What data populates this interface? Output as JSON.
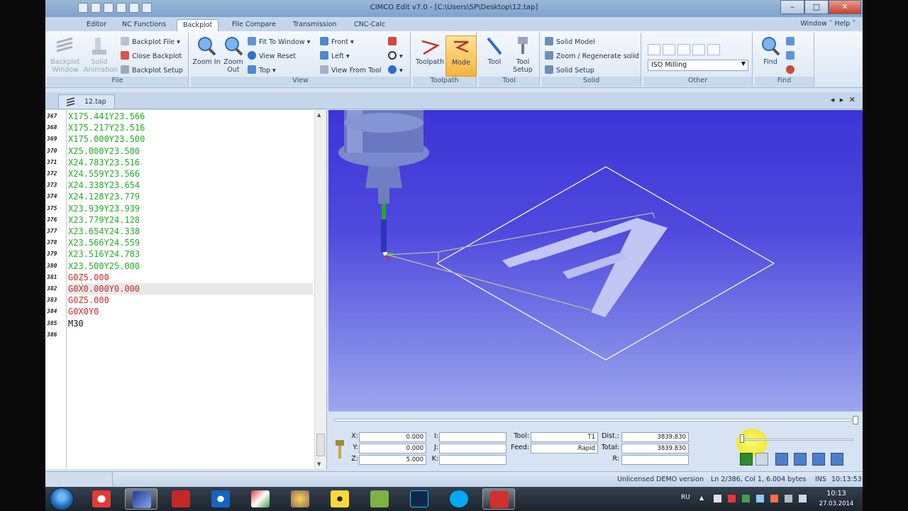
{
  "window": {
    "title": "CIMCO Edit v7.0 - [C:\\Users\\SP\\Desktop\\12.tap]",
    "min": "–",
    "max": "□",
    "close": "✕"
  },
  "menu": {
    "tabs": [
      "Editor",
      "NC Functions",
      "Backplot",
      "File Compare",
      "Transmission",
      "CNC-Calc"
    ],
    "active_tab": "Backplot",
    "right": "Window ˅  Help ˅"
  },
  "ribbon": {
    "file": {
      "label": "File",
      "backplot_window": "Backplot Window",
      "solid_animation": "Solid Animation",
      "backplot_file": "Backplot File",
      "close_backplot": "Close Backplot",
      "backplot_setup": "Backplot Setup"
    },
    "view": {
      "label": "View",
      "zoom_in": "Zoom In",
      "zoom_out": "Zoom Out",
      "fit_to_window": "Fit To Window",
      "view_reset": "View Reset",
      "top": "Top",
      "front": "Front",
      "left": "Left",
      "view_from_tool": "View From Tool"
    },
    "toolpath": {
      "label": "Toolpath",
      "toolpath": "Toolpath",
      "mode": "Mode"
    },
    "tool": {
      "label": "Tool",
      "tool": "Tool",
      "tool_setup": "Tool Setup"
    },
    "solid": {
      "label": "Solid",
      "solid_model": "Solid Model",
      "zoom_regenerate": "Zoom / Regenerate solid",
      "solid_setup": "Solid Setup"
    },
    "other": {
      "label": "Other",
      "machine_select": "ISO Milling"
    },
    "find": {
      "label": "Find",
      "find": "Find"
    }
  },
  "doc_tab": {
    "name": "12.tap",
    "nav": "◂ ▸ ✕"
  },
  "editor": {
    "lines": [
      {
        "no": "367",
        "code": "X175.441Y23.566",
        "color": "#1fb01f",
        "hl": false
      },
      {
        "no": "368",
        "code": "X175.217Y23.516",
        "color": "#1fb01f",
        "hl": false
      },
      {
        "no": "369",
        "code": "X175.000Y23.500",
        "color": "#1fb01f",
        "hl": false
      },
      {
        "no": "370",
        "code": "X25.000Y23.500",
        "color": "#1fb01f",
        "hl": false
      },
      {
        "no": "371",
        "code": "X24.783Y23.516",
        "color": "#1fb01f",
        "hl": false
      },
      {
        "no": "372",
        "code": "X24.559Y23.566",
        "color": "#1fb01f",
        "hl": false
      },
      {
        "no": "373",
        "code": "X24.338Y23.654",
        "color": "#1fb01f",
        "hl": false
      },
      {
        "no": "374",
        "code": "X24.128Y23.779",
        "color": "#1fb01f",
        "hl": false
      },
      {
        "no": "375",
        "code": "X23.939Y23.939",
        "color": "#1fb01f",
        "hl": false
      },
      {
        "no": "376",
        "code": "X23.779Y24.128",
        "color": "#1fb01f",
        "hl": false
      },
      {
        "no": "377",
        "code": "X23.654Y24.338",
        "color": "#1fb01f",
        "hl": false
      },
      {
        "no": "378",
        "code": "X23.566Y24.559",
        "color": "#1fb01f",
        "hl": false
      },
      {
        "no": "379",
        "code": "X23.516Y24.783",
        "color": "#1fb01f",
        "hl": false
      },
      {
        "no": "380",
        "code": "X23.500Y25.000",
        "color": "#1fb01f",
        "hl": false
      },
      {
        "no": "381",
        "code": "G0Z5.000",
        "color": "#d22a2a",
        "hl": false
      },
      {
        "no": "382",
        "code": "G0X0.000Y0.000",
        "color": "#d22a2a",
        "hl": true
      },
      {
        "no": "383",
        "code": "G0Z5.000",
        "color": "#d22a2a",
        "hl": false
      },
      {
        "no": "384",
        "code": "G0X0Y0",
        "color": "#d22a2a",
        "hl": false
      },
      {
        "no": "385",
        "code": "M30",
        "color": "#111111",
        "hl": false
      },
      {
        "no": "386",
        "code": "",
        "color": "#111111",
        "hl": false
      }
    ]
  },
  "info": {
    "x_label": "X:",
    "x_val": "0.000",
    "y_label": "Y:",
    "y_val": "0.000",
    "z_label": "Z:",
    "z_val": "5.000",
    "i_label": "I:",
    "j_label": "J:",
    "k_label": "K:",
    "tool_label": "Tool:",
    "tool_val": "T1",
    "feed_label": "Feed:",
    "feed_val": "Rapid",
    "dist_label": "Dist.:",
    "dist_val": "3839.830",
    "total_label": "Total:",
    "total_val": "3839.830",
    "r_label": "R:"
  },
  "status": {
    "license": "Unlicensed DEMO version",
    "position": "Ln 2/386, Col 1, 6.004 bytes",
    "mode": "INS",
    "time": "10:13:53"
  },
  "taskbar": {
    "lang": "RU",
    "clock_time": "10:13",
    "clock_date": "27.03.2014"
  }
}
